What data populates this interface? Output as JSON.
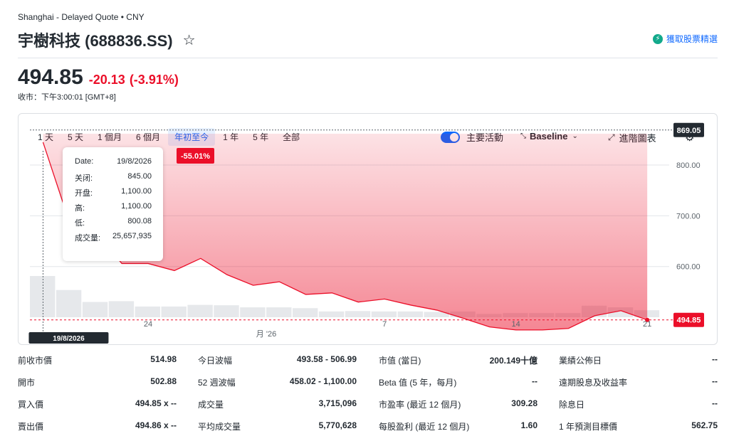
{
  "header": {
    "exchange": "Shanghai - Delayed Quote • CNY",
    "title": "宇樹科技 (688836.SS)",
    "star_icon": "☆",
    "alert_label": "獲取股票精選",
    "alert_icon": "⚡"
  },
  "quote": {
    "price": "494.85",
    "change": "-20.13",
    "change_pct": "(-3.91%)",
    "market_time": "收市：下午3:00:01 [GMT+8]",
    "down_color": "#eb0f29"
  },
  "toolbar": {
    "ranges": [
      "1 天",
      "5 天",
      "1 個月",
      "6 個月",
      "年初至今",
      "1 年",
      "5 年",
      "全部"
    ],
    "active_range": "年初至今",
    "toggle_label": "主要活動",
    "baseline_label": "Baseline",
    "advanced_label": "進階圖表",
    "settings_icon": "⚙",
    "accent_color": "#0f69ff"
  },
  "chart_data": {
    "type": "area",
    "baseline_value": 869.05,
    "baseline_label": "869.05",
    "last_value": 494.85,
    "last_label": "494.85",
    "ytd_change_label": "-55.01%",
    "y_ticks": [
      600,
      700,
      800
    ],
    "y_tick_labels": [
      "600.00",
      "700.00",
      "800.00"
    ],
    "ylim": [
      444,
      901
    ],
    "x_ticks": [
      {
        "day": 4,
        "label": "24"
      },
      {
        "day": 13,
        "label": "7"
      },
      {
        "day": 18,
        "label": "14"
      },
      {
        "day": 23,
        "label": "21"
      }
    ],
    "month_label": "月 '26",
    "crosshair_day": 0.5,
    "crosshair_label": "19/8/2026",
    "points": [
      {
        "day": 0.5,
        "close": 845
      },
      {
        "day": 1.5,
        "close": 688
      },
      {
        "day": 2.5,
        "close": 667
      },
      {
        "day": 3.5,
        "close": 606
      },
      {
        "day": 4.5,
        "close": 606
      },
      {
        "day": 5.5,
        "close": 592
      },
      {
        "day": 6.5,
        "close": 616
      },
      {
        "day": 7.5,
        "close": 584
      },
      {
        "day": 8.5,
        "close": 563
      },
      {
        "day": 9.5,
        "close": 570
      },
      {
        "day": 10.5,
        "close": 545
      },
      {
        "day": 11.5,
        "close": 548
      },
      {
        "day": 12.5,
        "close": 530
      },
      {
        "day": 13.5,
        "close": 536
      },
      {
        "day": 14.5,
        "close": 524
      },
      {
        "day": 15.5,
        "close": 514
      },
      {
        "day": 16.5,
        "close": 498
      },
      {
        "day": 17.5,
        "close": 481
      },
      {
        "day": 18.5,
        "close": 475
      },
      {
        "day": 19.5,
        "close": 475
      },
      {
        "day": 20.5,
        "close": 478
      },
      {
        "day": 21.5,
        "close": 503
      },
      {
        "day": 22.5,
        "close": 513
      },
      {
        "day": 23.5,
        "close": 494.85
      }
    ],
    "volume": [
      1.0,
      0.66,
      0.37,
      0.39,
      0.26,
      0.26,
      0.3,
      0.29,
      0.24,
      0.24,
      0.22,
      0.14,
      0.15,
      0.14,
      0.14,
      0.13,
      0.14,
      0.08,
      0.1,
      0.1,
      0.1,
      0.28,
      0.24,
      0.17
    ],
    "line_color": "#eb0f29",
    "fill_color": "#eb0f29"
  },
  "tooltip": {
    "rows": [
      {
        "label": "Date:",
        "value": "19/8/2026"
      },
      {
        "label": "关闭:",
        "value": "845.00"
      },
      {
        "label": "开盘:",
        "value": "1,100.00"
      },
      {
        "label": "高:",
        "value": "1,100.00"
      },
      {
        "label": "低:",
        "value": "800.08"
      },
      {
        "label": "成交量:",
        "value": "25,657,935"
      }
    ]
  },
  "stats": {
    "col1": [
      {
        "label": "前收市價",
        "value": "514.98"
      },
      {
        "label": "開市",
        "value": "502.88"
      },
      {
        "label": "買入價",
        "value": "494.85 x --"
      },
      {
        "label": "賣出價",
        "value": "494.86 x --"
      }
    ],
    "col2": [
      {
        "label": "今日波幅",
        "value": "493.58 - 506.99"
      },
      {
        "label": "52 週波幅",
        "value": "458.02 - 1,100.00"
      },
      {
        "label": "成交量",
        "value": "3,715,096"
      },
      {
        "label": "平均成交量",
        "value": "5,770,628"
      }
    ],
    "col3": [
      {
        "label": "市值 (當日)",
        "value": "200.149十億"
      },
      {
        "label": "Beta 值 (5 年，每月)",
        "value": "--"
      },
      {
        "label": "市盈率 (最近 12 個月)",
        "value": "309.28"
      },
      {
        "label": "每股盈利 (最近 12 個月)",
        "value": "1.60"
      }
    ],
    "col4": [
      {
        "label": "業績公佈日",
        "value": "--"
      },
      {
        "label": "遠期股息及收益率",
        "value": "--"
      },
      {
        "label": "除息日",
        "value": "--"
      },
      {
        "label": "1 年預測目標價",
        "value": "562.75"
      }
    ]
  }
}
